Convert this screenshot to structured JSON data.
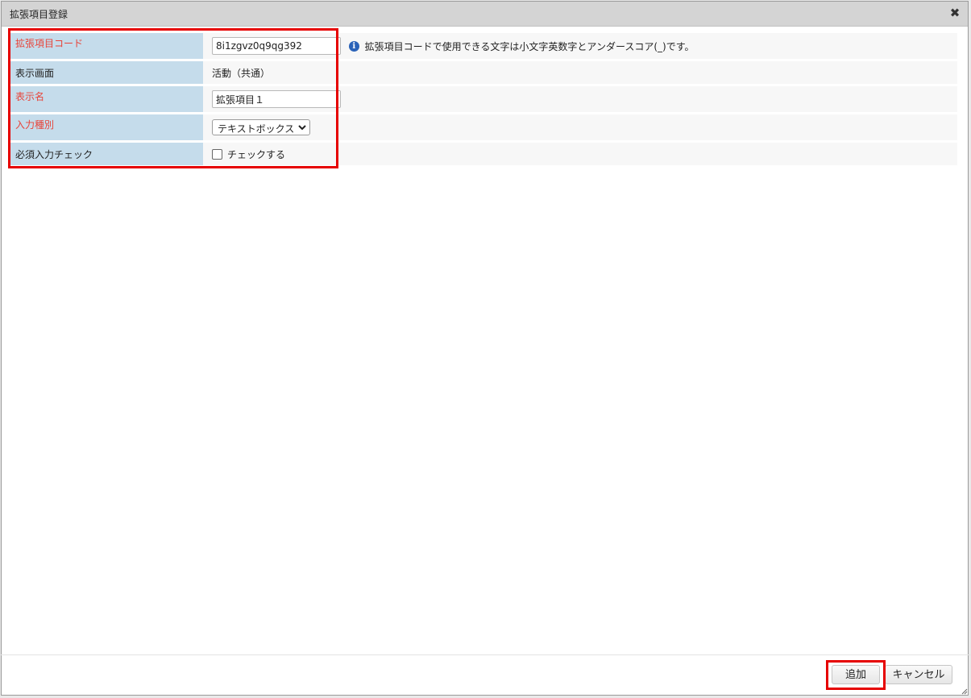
{
  "dialog": {
    "title": "拡張項目登録",
    "close_icon": "close-icon"
  },
  "form": {
    "code": {
      "label": "拡張項目コード",
      "value": "8i1zgvz0q9qg392",
      "hint": "拡張項目コードで使用できる文字は小文字英数字とアンダースコア(_)です。",
      "info_icon": "info-icon"
    },
    "screen": {
      "label": "表示画面",
      "value": "活動（共通）"
    },
    "display_name": {
      "label": "表示名",
      "value": "拡張項目１"
    },
    "input_type": {
      "label": "入力種別",
      "selected": "テキストボックス"
    },
    "required": {
      "label": "必須入力チェック",
      "checkbox_label": "チェックする",
      "checked": false
    }
  },
  "footer": {
    "add_label": "追加",
    "cancel_label": "キャンセル"
  },
  "colors": {
    "required_label": "#e8443a",
    "label_bg": "#c5dceb",
    "highlight": "#e60000"
  }
}
